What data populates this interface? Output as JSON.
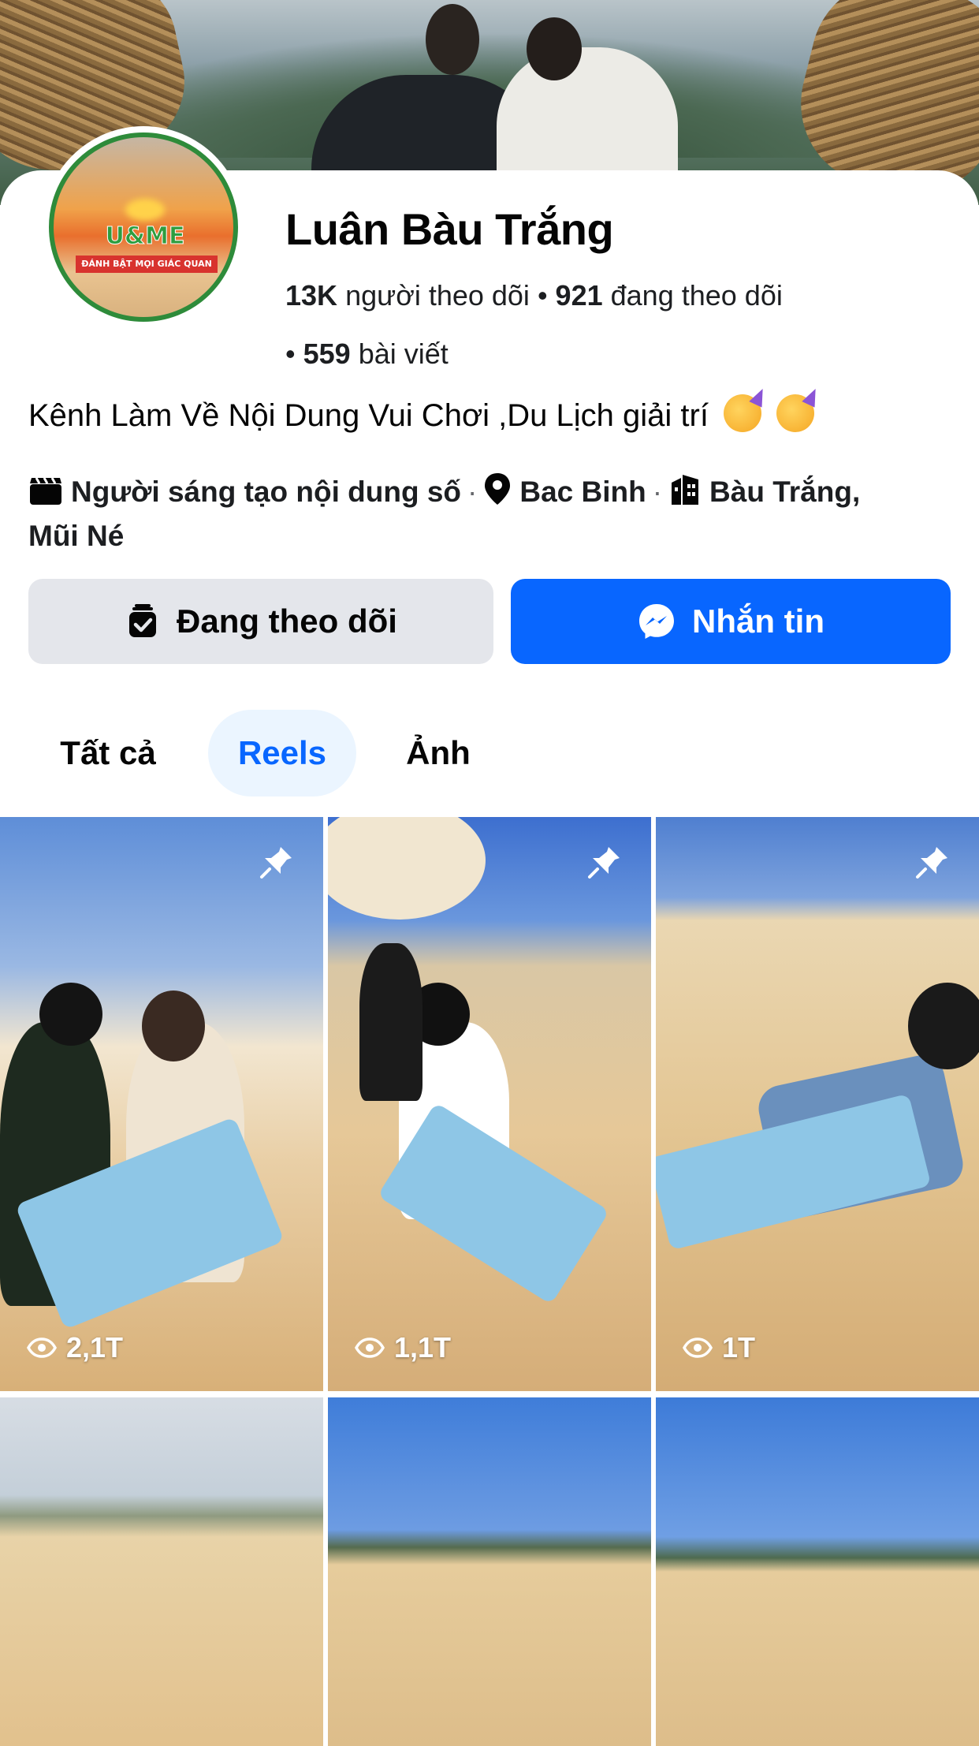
{
  "profile": {
    "name": "Luân Bàu Trắng",
    "followers_count": "13K",
    "followers_label": "người theo dõi",
    "following_count": "921",
    "following_label": "đang theo dõi",
    "posts_count": "559",
    "posts_label": "bài viết",
    "bio": "Kênh Làm Về Nội Dung Vui Chơi ,Du Lịch giải trí",
    "category": "Người sáng tạo nội dung số",
    "location": "Bac Binh",
    "place_line1": "Bàu Trắng,",
    "place_line2": "Mũi Né",
    "avatar_logo": "U&ME",
    "avatar_tagline": "ĐÁNH BẬT MỌI GIÁC QUAN"
  },
  "actions": {
    "following_label": "Đang theo dõi",
    "message_label": "Nhắn tin"
  },
  "tabs": [
    {
      "label": "Tất cả",
      "active": false
    },
    {
      "label": "Reels",
      "active": true
    },
    {
      "label": "Ảnh",
      "active": false
    }
  ],
  "reels": [
    {
      "views": "2,1T",
      "pinned": true
    },
    {
      "views": "1,1T",
      "pinned": true
    },
    {
      "views": "1T",
      "pinned": true
    },
    {
      "views": "",
      "pinned": false
    },
    {
      "views": "",
      "pinned": false
    },
    {
      "views": "",
      "pinned": false
    }
  ],
  "colors": {
    "accent": "#0866ff",
    "secondary_button": "#e4e6eb",
    "active_tab_bg": "#ebf5ff",
    "text": "#050505"
  },
  "icons": [
    "clapperboard-icon",
    "location-pin-icon",
    "building-icon",
    "following-check-icon",
    "messenger-icon",
    "pin-icon",
    "eye-icon"
  ]
}
